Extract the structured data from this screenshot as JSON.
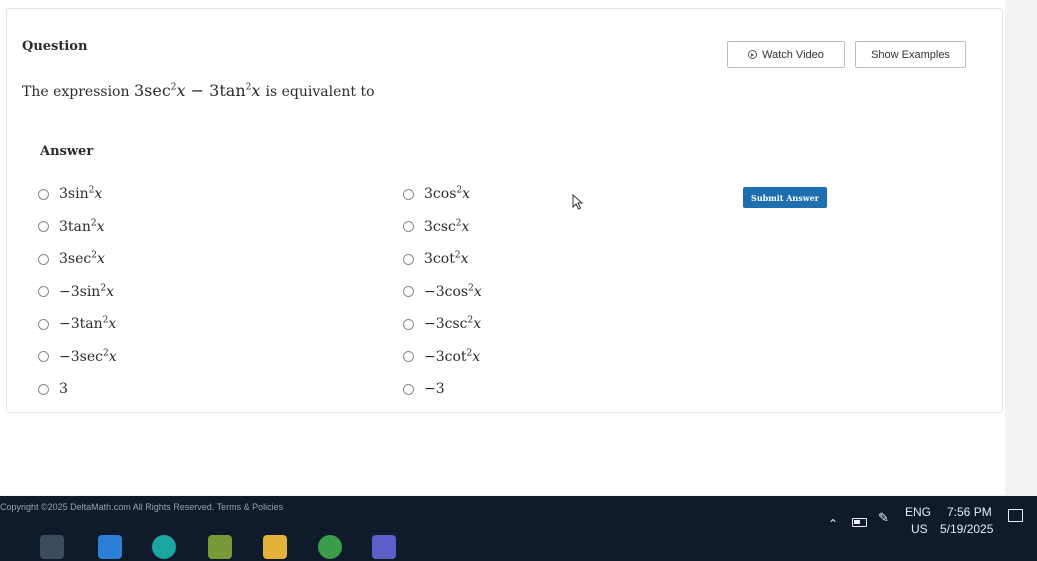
{
  "question": {
    "title": "Question",
    "watch_video": "Watch Video",
    "show_examples": "Show Examples",
    "prompt_prefix": "The expression",
    "prompt_suffix": "is equivalent to"
  },
  "answer": {
    "label": "Answer",
    "submit_label": "Submit Answer",
    "options": [
      {
        "coef": "3",
        "fn": "sin",
        "exp": "2",
        "var": "x"
      },
      {
        "coef": "3",
        "fn": "tan",
        "exp": "2",
        "var": "x"
      },
      {
        "coef": "3",
        "fn": "sec",
        "exp": "2",
        "var": "x"
      },
      {
        "coef": "−3",
        "fn": "sin",
        "exp": "2",
        "var": "x"
      },
      {
        "coef": "−3",
        "fn": "tan",
        "exp": "2",
        "var": "x"
      },
      {
        "coef": "−3",
        "fn": "sec",
        "exp": "2",
        "var": "x"
      },
      {
        "coef": "3",
        "fn": "",
        "exp": "",
        "var": ""
      },
      {
        "coef": "3",
        "fn": "cos",
        "exp": "2",
        "var": "x"
      },
      {
        "coef": "3",
        "fn": "csc",
        "exp": "2",
        "var": "x"
      },
      {
        "coef": "3",
        "fn": "cot",
        "exp": "2",
        "var": "x"
      },
      {
        "coef": "−3",
        "fn": "cos",
        "exp": "2",
        "var": "x"
      },
      {
        "coef": "−3",
        "fn": "csc",
        "exp": "2",
        "var": "x"
      },
      {
        "coef": "−3",
        "fn": "cot",
        "exp": "2",
        "var": "x"
      },
      {
        "coef": "−3",
        "fn": "",
        "exp": "",
        "var": ""
      }
    ]
  },
  "expression": {
    "c1": "3",
    "f1": "sec",
    "e1": "2",
    "v1": "x",
    "op": "−",
    "c2": "3",
    "f2": "tan",
    "e2": "2",
    "v2": "x"
  },
  "footer": {
    "copyright": "Copyright ©2025 DeltaMath.com All Rights Reserved.",
    "terms": "Terms & Policies"
  },
  "taskbar": {
    "lang1": "ENG",
    "lang2": "US",
    "time": "7:56 PM",
    "date": "5/19/2025",
    "accent": "#0f1a2b"
  }
}
